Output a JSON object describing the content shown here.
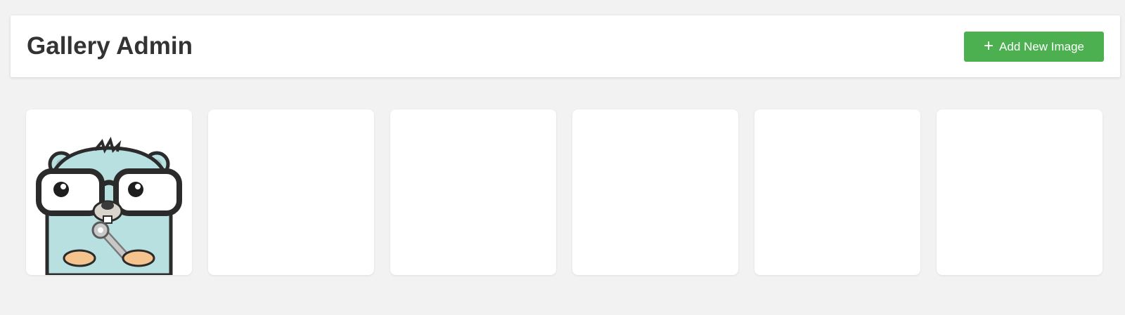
{
  "header": {
    "title": "Gallery Admin",
    "add_button": {
      "label": "Add New Image",
      "icon": "plus-icon"
    }
  },
  "colors": {
    "background": "#f2f2f2",
    "header_bg": "#ffffff",
    "title": "#333333",
    "button": "#4cb050",
    "button_text": "#ffffff"
  },
  "gallery": {
    "items": [
      {
        "kind": "illustration",
        "subject": "gopher mascot with glasses and wrench"
      },
      {
        "kind": "photo-pixelated",
        "palette": [
          "#f2a6ad",
          "#e89a9c",
          "#8e4c45",
          "#7a4a48",
          "#b8394a",
          "#e8506b",
          "#6e2a33",
          "#9c7f84"
        ]
      },
      {
        "kind": "photo-pixelated",
        "palette": [
          "#e8745e",
          "#f78c77",
          "#a97fa0",
          "#4a519b",
          "#7b88d2",
          "#8d3b2c",
          "#c7801e",
          "#2a2f5a",
          "#de6438"
        ]
      },
      {
        "kind": "photo-pixelated",
        "palette": [
          "#e6a8ad",
          "#8c4f4f",
          "#b65761",
          "#e05168",
          "#6e3a3a",
          "#1a1a2e",
          "#f0567a",
          "#5e2240",
          "#7a6a7e"
        ]
      },
      {
        "kind": "photo-pixelated",
        "palette": [
          "#d6a042",
          "#e8b64a",
          "#b54166",
          "#2a7a44",
          "#4f4f3e",
          "#a87a3e",
          "#15132a",
          "#6a4a3c",
          "#d85899"
        ]
      },
      {
        "kind": "photo-pixelated",
        "palette": [
          "#a88a6a",
          "#e2b888",
          "#c89a5e",
          "#a87a4a",
          "#3a322e",
          "#4a3a2a",
          "#d8a858",
          "#281c1a",
          "#8a6a4a"
        ]
      }
    ]
  }
}
